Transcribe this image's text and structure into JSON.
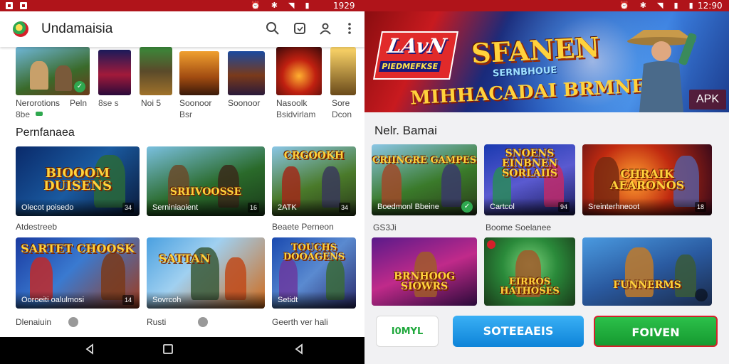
{
  "left": {
    "statusbar": {
      "clock": "1929",
      "icons": [
        "alarm-icon",
        "bluetooth-icon",
        "wifi-icon",
        "signal-icon",
        "battery-icon"
      ]
    },
    "appbar": {
      "title": "Undamaisia",
      "icons": [
        "search-icon",
        "cast-icon",
        "account-icon",
        "more-vert-icon"
      ]
    },
    "top_row": [
      {
        "name": "Nerorotions",
        "meta": "8be"
      },
      {
        "name": "Peln",
        "meta": "8se  s"
      },
      {
        "name": "Noi  5",
        "meta": ""
      },
      {
        "name": "Soonoor",
        "meta": "Bsr"
      },
      {
        "name": "Nasoolk",
        "meta": "Bsidvirlam"
      },
      {
        "name": "Sore",
        "meta": "Dcon"
      }
    ],
    "section1_title": "Pernfanaea",
    "section1_cards": [
      {
        "art": "BIOOOM DUISENS",
        "caption": "Olecot poisedo",
        "badge": "34"
      },
      {
        "art": "SRIIVOOSSE",
        "caption": "Serniniaoient",
        "badge": "16"
      },
      {
        "art": "CRGOOKH",
        "caption": "2ATK",
        "badge": "34"
      }
    ],
    "section1_labels": [
      "Atdestreeb",
      "",
      "Beaete Perneon"
    ],
    "section2_cards": [
      {
        "art": "SARTET CHOOSK",
        "caption": "Ooroeiti oalulmosi",
        "badge": "14"
      },
      {
        "art": "SATTAN",
        "caption": "Sovrcoh",
        "badge": ""
      },
      {
        "art": "TOUCHS DOOAGENS",
        "caption": "Setidt",
        "badge": ""
      }
    ],
    "section2_labels": [
      "Dlenaiuin",
      "Rusti",
      "Geerth ver hali"
    ],
    "navbar": [
      "back-icon",
      "home-icon",
      "back-icon"
    ]
  },
  "right": {
    "statusbar": {
      "clock": "12:90",
      "icons": [
        "alarm-icon",
        "bluetooth-icon",
        "wifi-icon",
        "signal-icon",
        "battery-icon"
      ]
    },
    "banner": {
      "logo_line1": "LAvN",
      "logo_line2": "PIEDMEFKSE",
      "title": "SFANEN",
      "subtitle": "SERNBHOUE",
      "subtitle2": "MIHHACADAI BRMNEI!!",
      "apk": "APK"
    },
    "section_title": "Nelr. Bamai",
    "cards_row1": [
      {
        "art": "CRIINGRE GAMPES",
        "caption": "Boedmonl Bbeine",
        "badge": "check"
      },
      {
        "art": "SNOENS EINBNEN SORLAIIS",
        "caption": "Cartcol",
        "badge": "94"
      },
      {
        "art": "CHRAIK AEARONOS",
        "caption": "Sreinterhneoot",
        "badge": "18"
      }
    ],
    "row1_labels": [
      "GS3Ji",
      "Boome Soelanee"
    ],
    "cards_row2": [
      {
        "art": "BRNHOOG SIOWRS",
        "caption": "",
        "badge": ""
      },
      {
        "art": "EIRROS HATHOSES",
        "caption": "",
        "badge": ""
      },
      {
        "art": "FUNNERMS",
        "caption": "",
        "badge": ""
      }
    ],
    "buttons": {
      "left": "I0MYL",
      "middle": "SOTEEAEIS",
      "right": "FOIVEN"
    }
  },
  "colors": {
    "statusbar": "#b0141a",
    "primary_blue": "#1592e6",
    "primary_green": "#1fa83c",
    "accent_red": "#d4202a"
  }
}
